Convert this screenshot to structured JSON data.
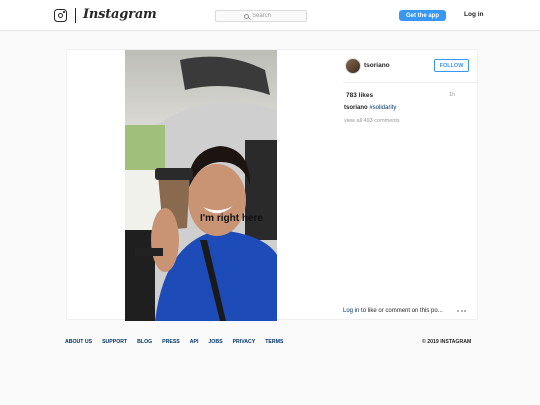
{
  "header": {
    "wordmark": "Instagram",
    "search_placeholder": "Search",
    "get_app_label": "Get the app",
    "login_label": "Log in"
  },
  "post": {
    "image_caption_text": "I'm right here",
    "username": "tsoriano",
    "follow_label": "FOLLOW",
    "likes": "783 likes",
    "time": "1h",
    "caption_user": "tsoriano",
    "caption_tag": "#solidarity",
    "view_comments": "view all 493 comments",
    "login_link": "Log in",
    "login_suffix": " to like or comment on this po..."
  },
  "footer": {
    "links": [
      "ABOUT US",
      "SUPPORT",
      "BLOG",
      "PRESS",
      "API",
      "JOBS",
      "PRIVACY",
      "TERMS"
    ],
    "copyright": "© 2019 INSTAGRAM"
  },
  "colors": {
    "accent": "#3897f0",
    "link": "#003569",
    "text": "#262626",
    "muted": "#999999"
  }
}
